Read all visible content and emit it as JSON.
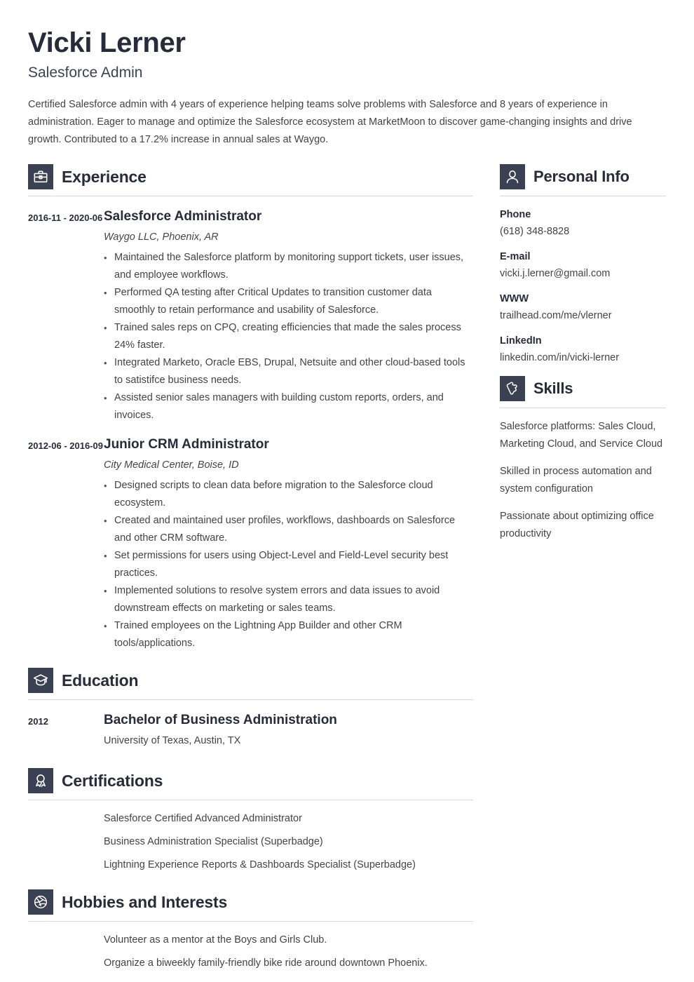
{
  "header": {
    "name": "Vicki Lerner",
    "job_title": "Salesforce Admin",
    "summary": "Certified Salesforce admin with 4 years of experience helping teams solve problems with Salesforce and 8 years of experience in administration. Eager to manage and optimize the Salesforce ecosystem at MarketMoon to discover game-changing insights and drive growth. Contributed to a 17.2% increase in annual sales at Waygo."
  },
  "colors": {
    "icon_background": "#3a4152",
    "heading": "#272c3a",
    "body_text": "#444444",
    "divider": "#d8d8d8",
    "page_background": "#ffffff"
  },
  "sections": {
    "experience": {
      "title": "Experience",
      "icon": "briefcase-icon",
      "entries": [
        {
          "date": "2016-11 - 2020-06",
          "title": "Salesforce Administrator",
          "company": "Waygo LLC, Phoenix, AR",
          "bullets": [
            "Maintained the Salesforce platform by monitoring support tickets, user issues, and employee workflows.",
            "Performed QA testing after Critical Updates to transition customer data smoothly to retain performance and usability of Salesforce.",
            "Trained sales reps on CPQ, creating efficiencies that made the sales process 24% faster.",
            "Integrated Marketo, Oracle EBS, Drupal, Netsuite and other cloud-based tools to satistifce business needs.",
            "Assisted senior sales managers with building custom reports, orders, and invoices."
          ]
        },
        {
          "date": "2012-06 - 2016-09",
          "title": "Junior CRM Administrator",
          "company": "City Medical Center, Boise, ID",
          "bullets": [
            "Designed scripts to clean data before migration to the Salesforce cloud ecosystem.",
            "Created and maintained user profiles, workflows, dashboards on Salesforce and other CRM software.",
            "Set permissions for users using Object-Level and Field-Level security best practices.",
            "Implemented solutions to resolve system errors and data issues to avoid downstream effects on marketing or sales teams.",
            "Trained employees on the Lightning App Builder and other CRM tools/applications."
          ]
        }
      ]
    },
    "education": {
      "title": "Education",
      "icon": "graduation-cap-icon",
      "entries": [
        {
          "date": "2012",
          "title": "Bachelor of Business Administration",
          "school": "University of Texas, Austin, TX"
        }
      ]
    },
    "certifications": {
      "title": "Certifications",
      "icon": "award-ribbon-icon",
      "items": [
        "Salesforce Certified Advanced Administrator",
        "Business Administration Specialist (Superbadge)",
        "Lightning Experience Reports & Dashboards Specialist (Superbadge)"
      ]
    },
    "hobbies": {
      "title": "Hobbies and Interests",
      "icon": "dribbble-ball-icon",
      "items": [
        "Volunteer as a mentor at the Boys and Girls Club.",
        "Organize a biweekly family-friendly bike ride around downtown Phoenix."
      ]
    },
    "personal_info": {
      "title": "Personal Info",
      "icon": "user-icon",
      "fields": [
        {
          "label": "Phone",
          "value": "(618) 348-8828"
        },
        {
          "label": "E-mail",
          "value": "vicki.j.lerner@gmail.com"
        },
        {
          "label": "WWW",
          "value": "trailhead.com/me/vlerner"
        },
        {
          "label": "LinkedIn",
          "value": "linkedin.com/in/vicki-lerner"
        }
      ]
    },
    "skills": {
      "title": "Skills",
      "icon": "puzzle-piece-icon",
      "items": [
        "Salesforce platforms: Sales Cloud, Marketing Cloud, and Service Cloud",
        "Skilled in process automation and system configuration",
        "Passionate about optimizing office productivity"
      ]
    }
  }
}
